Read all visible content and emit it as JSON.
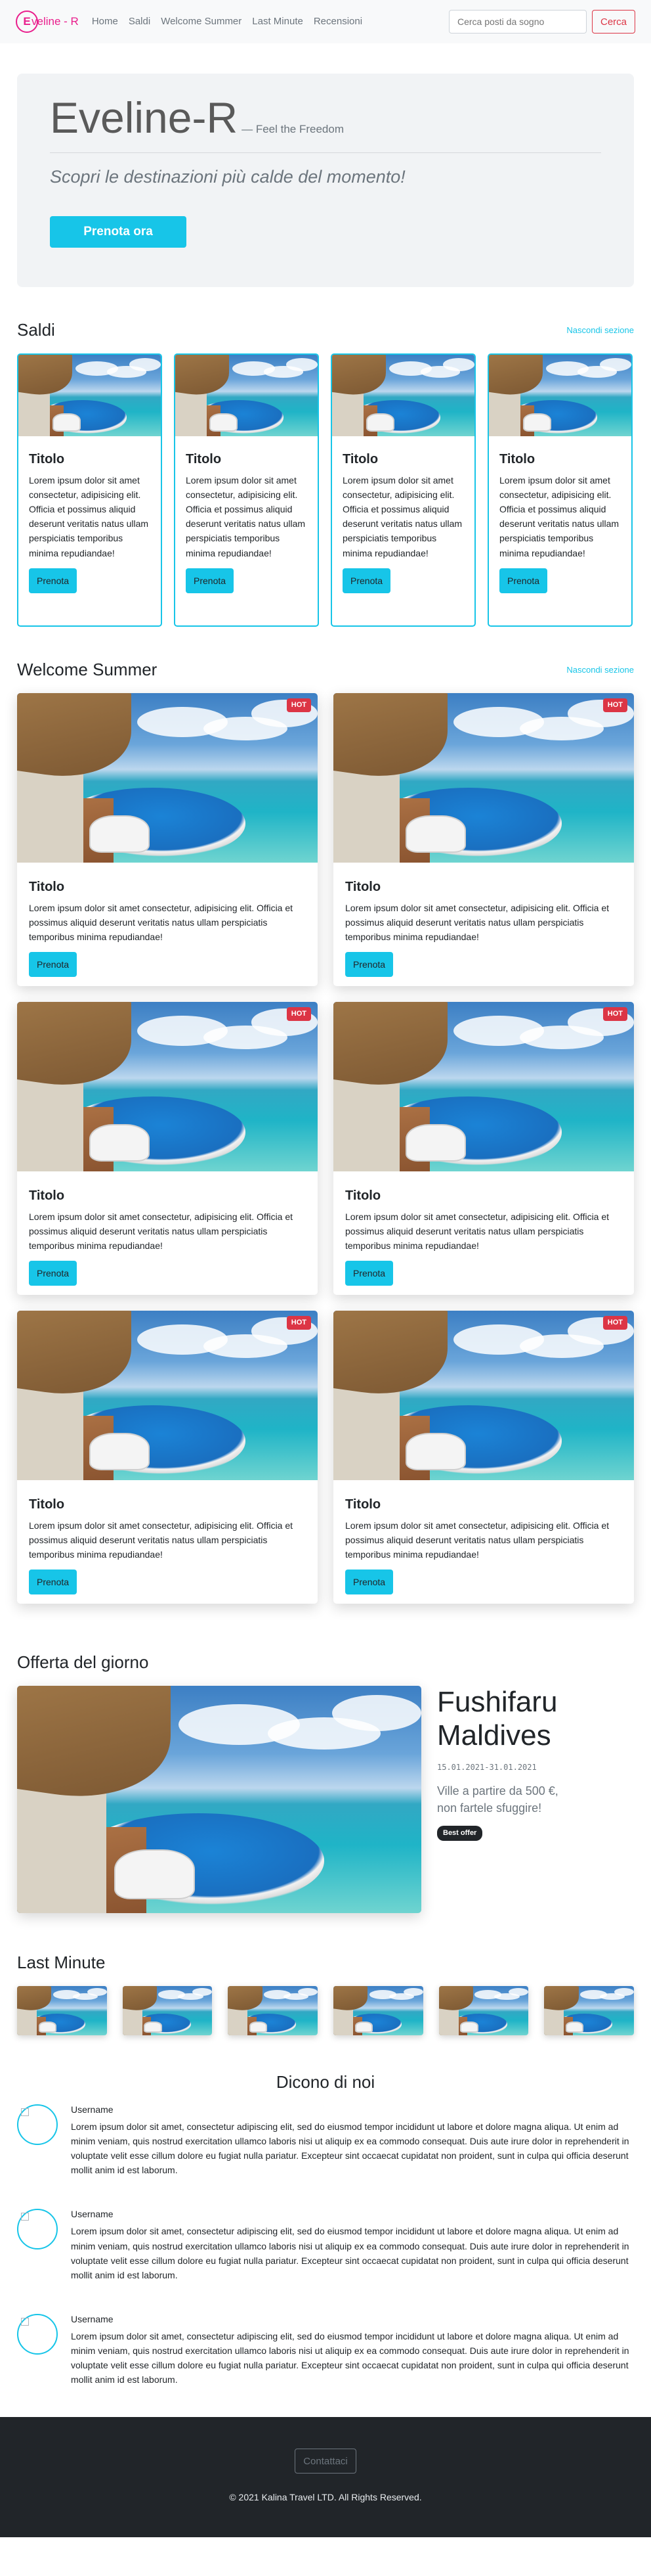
{
  "nav": {
    "brand_mark": "E",
    "brand_first": "veline",
    "brand_sep": " - ",
    "brand_second": "R",
    "links": [
      "Home",
      "Saldi",
      "Welcome Summer",
      "Last Minute",
      "Recensioni"
    ],
    "search_placeholder": "Cerca posti da sogno",
    "search_button": "Cerca"
  },
  "hero": {
    "title": "Eveline-R",
    "tagline": "— Feel the Freedom",
    "subtitle": "Scopri le destinazioni più calde del momento!",
    "cta": "Prenota ora"
  },
  "saldi": {
    "heading": "Saldi",
    "hide_link": "Nascondi sezione",
    "cards": [
      {
        "title": "Titolo",
        "text": "Lorem ipsum dolor sit amet consectetur, adipisicing elit. Officia et possimus aliquid deserunt veritatis natus ullam perspiciatis temporibus minima repudiandae!",
        "button": "Prenota"
      },
      {
        "title": "Titolo",
        "text": "Lorem ipsum dolor sit amet consectetur, adipisicing elit. Officia et possimus aliquid deserunt veritatis natus ullam perspiciatis temporibus minima repudiandae!",
        "button": "Prenota"
      },
      {
        "title": "Titolo",
        "text": "Lorem ipsum dolor sit amet consectetur, adipisicing elit. Officia et possimus aliquid deserunt veritatis natus ullam perspiciatis temporibus minima repudiandae!",
        "button": "Prenota"
      },
      {
        "title": "Titolo",
        "text": "Lorem ipsum dolor sit amet consectetur, adipisicing elit. Officia et possimus aliquid deserunt veritatis natus ullam perspiciatis temporibus minima repudiandae!",
        "button": "Prenota"
      }
    ]
  },
  "welcome": {
    "heading": "Welcome Summer",
    "hide_link": "Nascondi sezione",
    "cards": [
      {
        "badge": "HOT",
        "title": "Titolo",
        "text": "Lorem ipsum dolor sit amet consectetur, adipisicing elit. Officia et possimus aliquid deserunt veritatis natus ullam perspiciatis temporibus minima repudiandae!",
        "button": "Prenota"
      },
      {
        "badge": "HOT",
        "title": "Titolo",
        "text": "Lorem ipsum dolor sit amet consectetur, adipisicing elit. Officia et possimus aliquid deserunt veritatis natus ullam perspiciatis temporibus minima repudiandae!",
        "button": "Prenota"
      },
      {
        "badge": "HOT",
        "title": "Titolo",
        "text": "Lorem ipsum dolor sit amet consectetur, adipisicing elit. Officia et possimus aliquid deserunt veritatis natus ullam perspiciatis temporibus minima repudiandae!",
        "button": "Prenota"
      },
      {
        "badge": "HOT",
        "title": "Titolo",
        "text": "Lorem ipsum dolor sit amet consectetur, adipisicing elit. Officia et possimus aliquid deserunt veritatis natus ullam perspiciatis temporibus minima repudiandae!",
        "button": "Prenota"
      },
      {
        "badge": "HOT",
        "title": "Titolo",
        "text": "Lorem ipsum dolor sit amet consectetur, adipisicing elit. Officia et possimus aliquid deserunt veritatis natus ullam perspiciatis temporibus minima repudiandae!",
        "button": "Prenota"
      },
      {
        "badge": "HOT",
        "title": "Titolo",
        "text": "Lorem ipsum dolor sit amet consectetur, adipisicing elit. Officia et possimus aliquid deserunt veritatis natus ullam perspiciatis temporibus minima repudiandae!",
        "button": "Prenota"
      }
    ]
  },
  "offerta": {
    "heading": "Offerta del giorno",
    "destination_line1": "Fushifaru",
    "destination_line2": "Maldives",
    "dates": "15.01.2021-31.01.2021",
    "price_line1": "Ville a partire da 500 €,",
    "price_line2": "non fartele sfuggire!",
    "badge": "Best offer"
  },
  "last_minute": {
    "heading": "Last Minute",
    "count_thumbs": 6
  },
  "reviews": {
    "heading": "Dicono di noi",
    "items": [
      {
        "user": "Username",
        "text": "Lorem ipsum dolor sit amet, consectetur adipiscing elit, sed do eiusmod tempor incididunt ut labore et dolore magna aliqua. Ut enim ad minim veniam, quis nostrud exercitation ullamco laboris nisi ut aliquip ex ea commodo consequat. Duis aute irure dolor in reprehenderit in voluptate velit esse cillum dolore eu fugiat nulla pariatur. Excepteur sint occaecat cupidatat non proident, sunt in culpa qui officia deserunt mollit anim id est laborum."
      },
      {
        "user": "Username",
        "text": "Lorem ipsum dolor sit amet, consectetur adipiscing elit, sed do eiusmod tempor incididunt ut labore et dolore magna aliqua. Ut enim ad minim veniam, quis nostrud exercitation ullamco laboris nisi ut aliquip ex ea commodo consequat. Duis aute irure dolor in reprehenderit in voluptate velit esse cillum dolore eu fugiat nulla pariatur. Excepteur sint occaecat cupidatat non proident, sunt in culpa qui officia deserunt mollit anim id est laborum."
      },
      {
        "user": "Username",
        "text": "Lorem ipsum dolor sit amet, consectetur adipiscing elit, sed do eiusmod tempor incididunt ut labore et dolore magna aliqua. Ut enim ad minim veniam, quis nostrud exercitation ullamco laboris nisi ut aliquip ex ea commodo consequat. Duis aute irure dolor in reprehenderit in voluptate velit esse cillum dolore eu fugiat nulla pariatur. Excepteur sint occaecat cupidatat non proident, sunt in culpa qui officia deserunt mollit anim id est laborum."
      }
    ]
  },
  "footer": {
    "contact_button": "Contattaci",
    "copyright": "© 2021 Kalina Travel LTD. All Rights Reserved."
  },
  "colors": {
    "accent": "#17c5e8",
    "brand": "#e91e8c",
    "danger": "#dc3545",
    "footer_bg": "#212529"
  }
}
